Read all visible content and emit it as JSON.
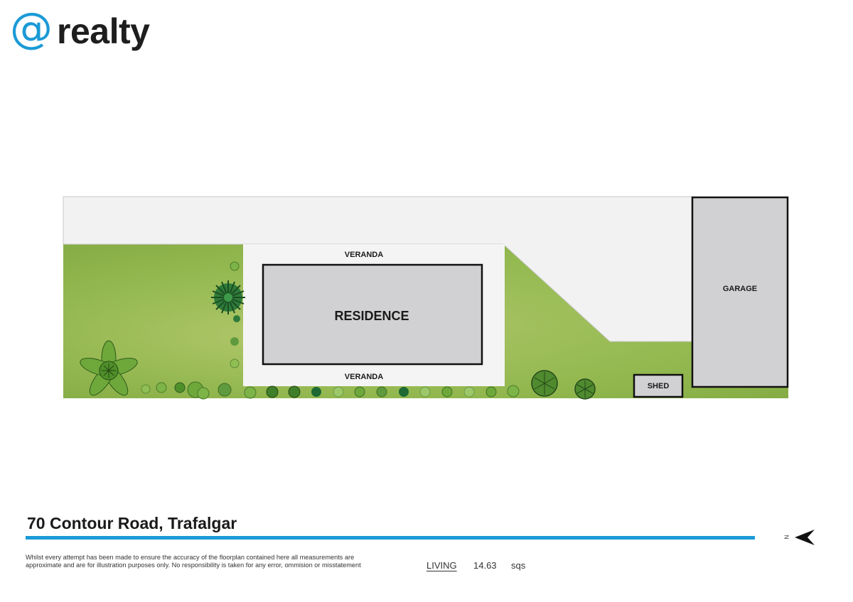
{
  "brand": {
    "at_symbol": "@",
    "name": "realty",
    "accent_color": "#1b9ad6"
  },
  "plan": {
    "residence_label": "RESIDENCE",
    "veranda_top_label": "VERANDA",
    "veranda_bottom_label": "VERANDA",
    "garage_label": "GARAGE",
    "shed_label": "SHED",
    "colors": {
      "lawn": "#9dbf5a",
      "driveway": "#f2f2f2",
      "building": "#d1d1d3",
      "outline": "#111111"
    }
  },
  "footer": {
    "address": "70 Contour Road, Trafalgar",
    "disclaimer": "Whilst every attempt has been made to ensure the accuracy of the floorplan contained here all measurements are approximate and are for illustration purposes only. No responsibility is taken for any error, ommision or misstatement",
    "area_label": "LIVING",
    "area_value": "14.63",
    "area_unit": "sqs",
    "north_letter": "N"
  }
}
